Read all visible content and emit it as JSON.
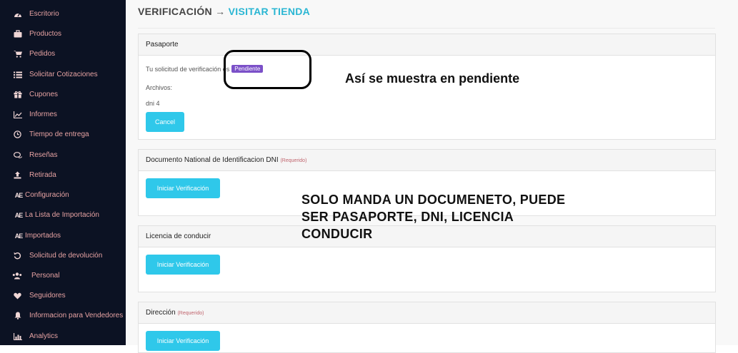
{
  "sidebar": {
    "items": [
      {
        "label": "Escritorio",
        "icon": "dashboard-icon"
      },
      {
        "label": "Productos",
        "icon": "briefcase-icon"
      },
      {
        "label": "Pedidos",
        "icon": "cart-icon"
      },
      {
        "label": "Solicitar Cotizaciones",
        "icon": "list-icon"
      },
      {
        "label": "Cupones",
        "icon": "gift-icon"
      },
      {
        "label": "Informes",
        "icon": "chart-icon"
      },
      {
        "label": "Tiempo de entrega",
        "icon": "clock-icon"
      },
      {
        "label": "Reseñas",
        "icon": "comments-icon"
      },
      {
        "label": "Retirada",
        "icon": "upload-icon"
      },
      {
        "label": "Configuración",
        "icon": "ae-icon",
        "icon_text": "AE"
      },
      {
        "label": "La Lista de Importación",
        "icon": "ae-icon",
        "icon_text": "AE"
      },
      {
        "label": "Importados",
        "icon": "ae-icon",
        "icon_text": "AE"
      },
      {
        "label": "Solicitud de devolución",
        "icon": "undo-icon"
      },
      {
        "label": "Personal",
        "icon": "users-icon"
      },
      {
        "label": "Seguidores",
        "icon": "heart-icon"
      },
      {
        "label": "Informacion para Vendedores",
        "icon": "bell-icon"
      },
      {
        "label": "Analytics",
        "icon": "bar-chart-icon"
      }
    ]
  },
  "header": {
    "title": "VERIFICACIÓN",
    "arrow": "→",
    "link": "VISITAR TIENDA"
  },
  "passport": {
    "title": "Pasaporte",
    "status_text": "Tu solicitud de verificación es",
    "status_badge": "Pendiente",
    "files_label": "Archivos:",
    "file_name": "dni 4",
    "cancel_label": "Cancel"
  },
  "dni": {
    "title": "Documento National de Identificacion DNI",
    "required": "(Requerido)",
    "button_label": "Iniciar Verificación"
  },
  "license": {
    "title": "Licencia de conducir",
    "button_label": "Iniciar Verificación"
  },
  "address": {
    "title": "Dirección",
    "required": "(Requerido)",
    "button_label": "Iniciar Verificación"
  },
  "annotations": {
    "pending_note": "Así se muestra en pendiente",
    "document_note_line1": "SOLO MANDA UN DOCUMENETO, PUEDE",
    "document_note_line2": "SER PASAPORTE, DNI, LICENCIA",
    "document_note_line3": "CONDUCIR"
  },
  "colors": {
    "sidebar_bg": "#0c1223",
    "sidebar_text": "#e6a2a2",
    "accent": "#2fc8ea",
    "link": "#2ab6d3",
    "badge_pending": "#7b50c8",
    "required": "#c0646d"
  }
}
